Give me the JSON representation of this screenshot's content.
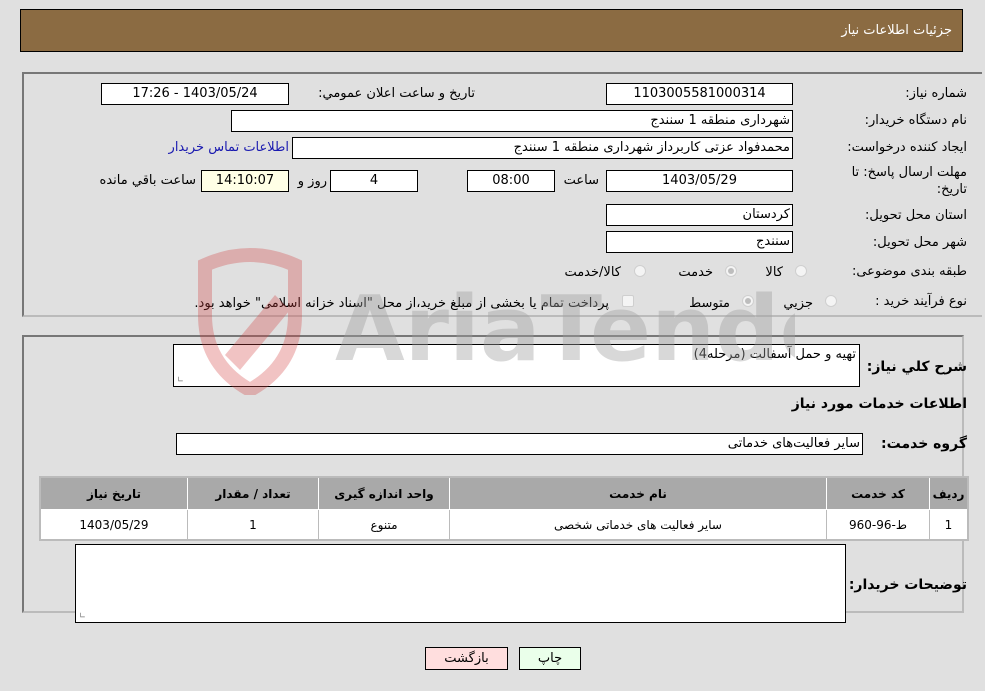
{
  "header": {
    "title": "جزئیات اطلاعات نیاز"
  },
  "need_info": {
    "need_number_label": "شماره نیاز:",
    "need_number": "1103005581000314",
    "announce_label": "تاریخ و ساعت اعلان عمومي:",
    "announce_value": "1403/05/24 - 17:26",
    "buyer_org_label": "نام دستگاه خریدار:",
    "buyer_org": "شهرداری منطقه 1 سنندج",
    "creator_label": "ایجاد کننده درخواست:",
    "creator": "محمدفواد عزتی کاربرداز شهرداری منطقه 1 سنندج",
    "contact_link": "اطلاعات تماس خریدار",
    "deadline_label_line1": "مهلت ارسال پاسخ: تا",
    "deadline_label_line2": "تاریخ:",
    "deadline_date": "1403/05/29",
    "time_label": "ساعت",
    "deadline_time": "08:00",
    "days_value": "4",
    "days_label": "روز و",
    "remaining_time": "14:10:07",
    "remaining_label": "ساعت باقي مانده",
    "province_label": "استان محل تحویل:",
    "province": "کردستان",
    "city_label": "شهر محل تحویل:",
    "city": "سنندج",
    "category_label": "طبقه بندی موضوعی:",
    "category_options": [
      {
        "label": "کالا",
        "checked": false
      },
      {
        "label": "خدمت",
        "checked": true
      },
      {
        "label": "کالا/خدمت",
        "checked": false
      }
    ],
    "purchase_type_label": "نوع فرآیند خرید :",
    "purchase_type_options": [
      {
        "label": "جزيي",
        "checked": false
      },
      {
        "label": "متوسط",
        "checked": true
      }
    ],
    "treasury_checkbox_label": "پرداخت تمام یا بخشی از مبلغ خرید،از محل \"اسناد خزانه اسلامی\" خواهد بود.",
    "treasury_checked": false
  },
  "details": {
    "summary_label": "شرح کلي نیاز:",
    "summary_value": "تهیه و حمل آسفالت (مرحله4)",
    "services_heading": "اطلاعات خدمات مورد نیاز",
    "service_group_label": "گروه خدمت:",
    "service_group_value": "سایر فعالیت‌های خدماتی",
    "table": {
      "headers": [
        "ردیف",
        "کد خدمت",
        "نام خدمت",
        "واحد اندازه گیری",
        "تعداد / مقدار",
        "تاریخ نیاز"
      ],
      "rows": [
        [
          "1",
          "ط-96-960",
          "سایر فعالیت های خدماتی شخصی",
          "متنوع",
          "1",
          "1403/05/29"
        ]
      ]
    },
    "buyer_notes_label": "توضیحات خریدار:",
    "buyer_notes_value": ""
  },
  "buttons": {
    "print": "چاپ",
    "back": "بازگشت"
  },
  "watermark": {
    "text": "AriaTender.neT"
  },
  "colors": {
    "header_bg": "#8b6b42",
    "print_button_bg": "#eaffea",
    "back_button_bg": "#ffdede",
    "link": "#1a1ab0",
    "remaining_bg": "#ffffe6"
  }
}
